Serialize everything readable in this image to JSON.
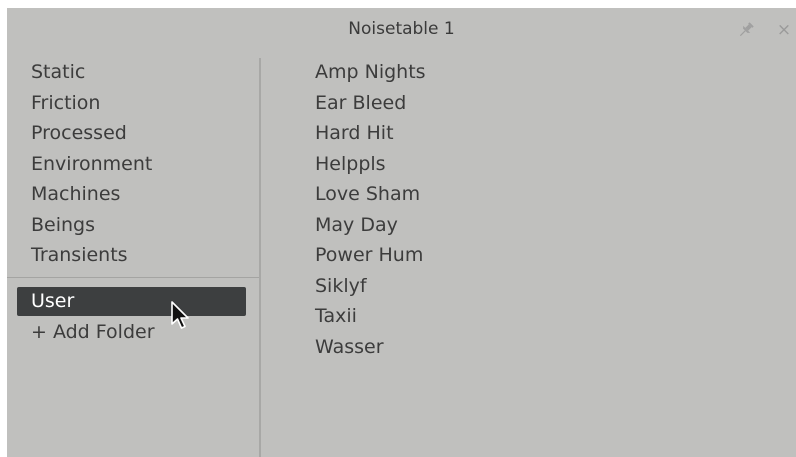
{
  "window": {
    "title": "Noisetable 1",
    "close_glyph": "×",
    "pin_icon": "pin-icon",
    "close_icon": "close-icon"
  },
  "categories": [
    {
      "label": "Static"
    },
    {
      "label": "Friction"
    },
    {
      "label": "Processed"
    },
    {
      "label": "Environment"
    },
    {
      "label": "Machines"
    },
    {
      "label": "Beings"
    },
    {
      "label": "Transients"
    }
  ],
  "user_folders": [
    {
      "label": "User",
      "selected": true
    },
    {
      "label": "+ Add Folder",
      "selected": false
    }
  ],
  "presets": [
    {
      "label": "Amp Nights"
    },
    {
      "label": "Ear Bleed"
    },
    {
      "label": "Hard Hit"
    },
    {
      "label": "Helppls"
    },
    {
      "label": "Love Sham"
    },
    {
      "label": "May Day"
    },
    {
      "label": "Power Hum"
    },
    {
      "label": "Siklyf"
    },
    {
      "label": "Taxii"
    },
    {
      "label": "Wasser"
    }
  ],
  "colors": {
    "background": "#c0c0be",
    "selection": "#3d3f40",
    "text": "#3c3c3c",
    "selected_text": "#ffffff"
  }
}
